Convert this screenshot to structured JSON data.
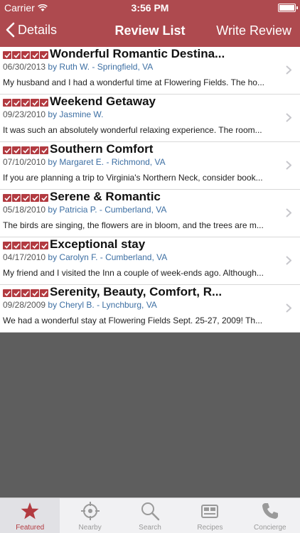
{
  "status_bar": {
    "carrier": "Carrier",
    "time": "3:56 PM"
  },
  "nav": {
    "back_label": "Details",
    "title": "Review List",
    "action_label": "Write Review"
  },
  "colors": {
    "brand": "#ae4a4f",
    "star": "#b23a40",
    "author_link": "#3d6fa3",
    "background": "#5e5e5e"
  },
  "reviews": [
    {
      "rating": 5,
      "title": "Wonderful Romantic Destina...",
      "date": "06/30/2013",
      "author": "by Ruth W. - Springfield, VA",
      "excerpt": "My husband and I had a wonderful time at Flowering Fields. The ho..."
    },
    {
      "rating": 5,
      "title": "Weekend Getaway",
      "date": "09/23/2010",
      "author": "by Jasmine W.",
      "excerpt": "It was such an absolutely wonderful relaxing experience. The room..."
    },
    {
      "rating": 5,
      "title": "Southern Comfort",
      "date": "07/10/2010",
      "author": "by Margaret E. - Richmond, VA",
      "excerpt": "If you are planning a trip to Virginia's Northern Neck, consider book..."
    },
    {
      "rating": 5,
      "title": "Serene & Romantic",
      "date": "05/18/2010",
      "author": "by Patricia P. - Cumberland, VA",
      "excerpt": "The birds are singing, the flowers are in bloom, and the trees are m..."
    },
    {
      "rating": 5,
      "title": "Exceptional stay",
      "date": "04/17/2010",
      "author": "by Carolyn F. - Cumberland, VA",
      "excerpt": "My friend and I visited the Inn a couple of week-ends ago. Although..."
    },
    {
      "rating": 5,
      "title": "Serenity, Beauty, Comfort, R...",
      "date": "09/28/2009",
      "author": "by Cheryl B. - Lynchburg, VA",
      "excerpt": "We had a wonderful stay at Flowering Fields Sept. 25-27, 2009! Th..."
    }
  ],
  "tabs": [
    {
      "label": "Featured",
      "icon": "star-icon",
      "active": true
    },
    {
      "label": "Nearby",
      "icon": "crosshair-icon",
      "active": false
    },
    {
      "label": "Search",
      "icon": "search-icon",
      "active": false
    },
    {
      "label": "Recipes",
      "icon": "recipes-icon",
      "active": false
    },
    {
      "label": "Concierge",
      "icon": "phone-icon",
      "active": false
    }
  ]
}
